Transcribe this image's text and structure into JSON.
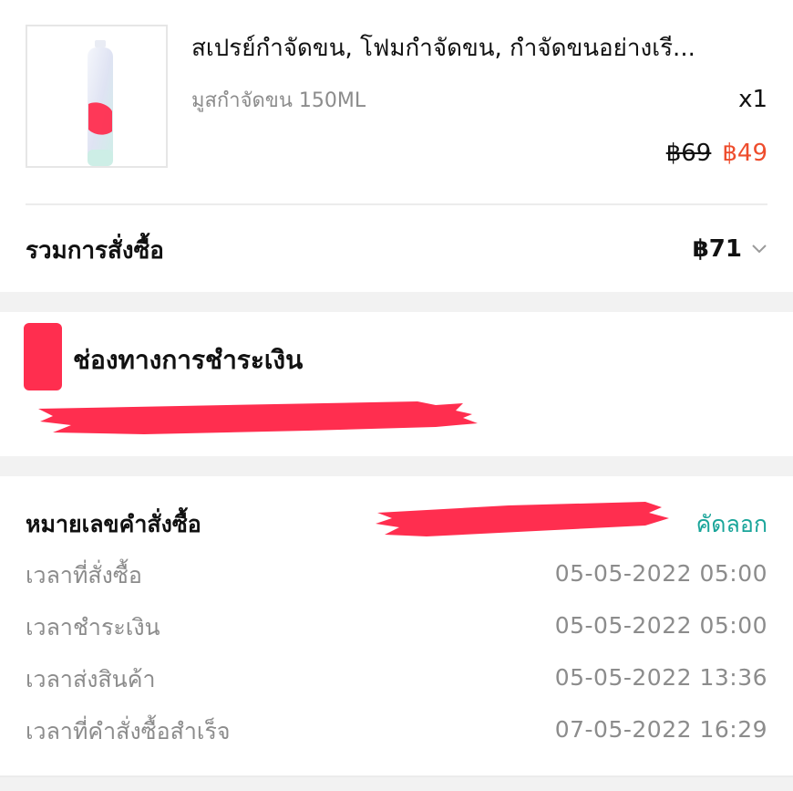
{
  "product": {
    "title": "สเปรย์กำจัดขน, โฟมกำจัดขน, กำจัดขนอย่างเรี...",
    "variant": "มูสกำจัดขน 150ML",
    "quantity": "x1",
    "original_price": "฿69",
    "sale_price": "฿49"
  },
  "order_total": {
    "label": "รวมการสั่งซื้อ",
    "value": "฿71",
    "expand_icon": "chevron-down-icon"
  },
  "payment": {
    "title": "ช่องทางการชำระเงิน"
  },
  "order_info": {
    "order_number_label": "หมายเลขคำสั่งซื้อ",
    "copy_label": "คัดลอก",
    "rows": [
      {
        "label": "เวลาที่สั่งซื้อ",
        "value": "05-05-2022 05:00"
      },
      {
        "label": "เวลาชำระเงิน",
        "value": "05-05-2022 05:00"
      },
      {
        "label": "เวลาส่งสินค้า",
        "value": "05-05-2022 13:36"
      },
      {
        "label": "เวลาที่คำสั่งซื้อสำเร็จ",
        "value": "07-05-2022 16:29"
      }
    ]
  },
  "colors": {
    "sale_price": "#ee4d2d",
    "copy_link": "#1aa59a",
    "redaction": "#ff2e4f",
    "section_gap": "#f2f2f2"
  }
}
